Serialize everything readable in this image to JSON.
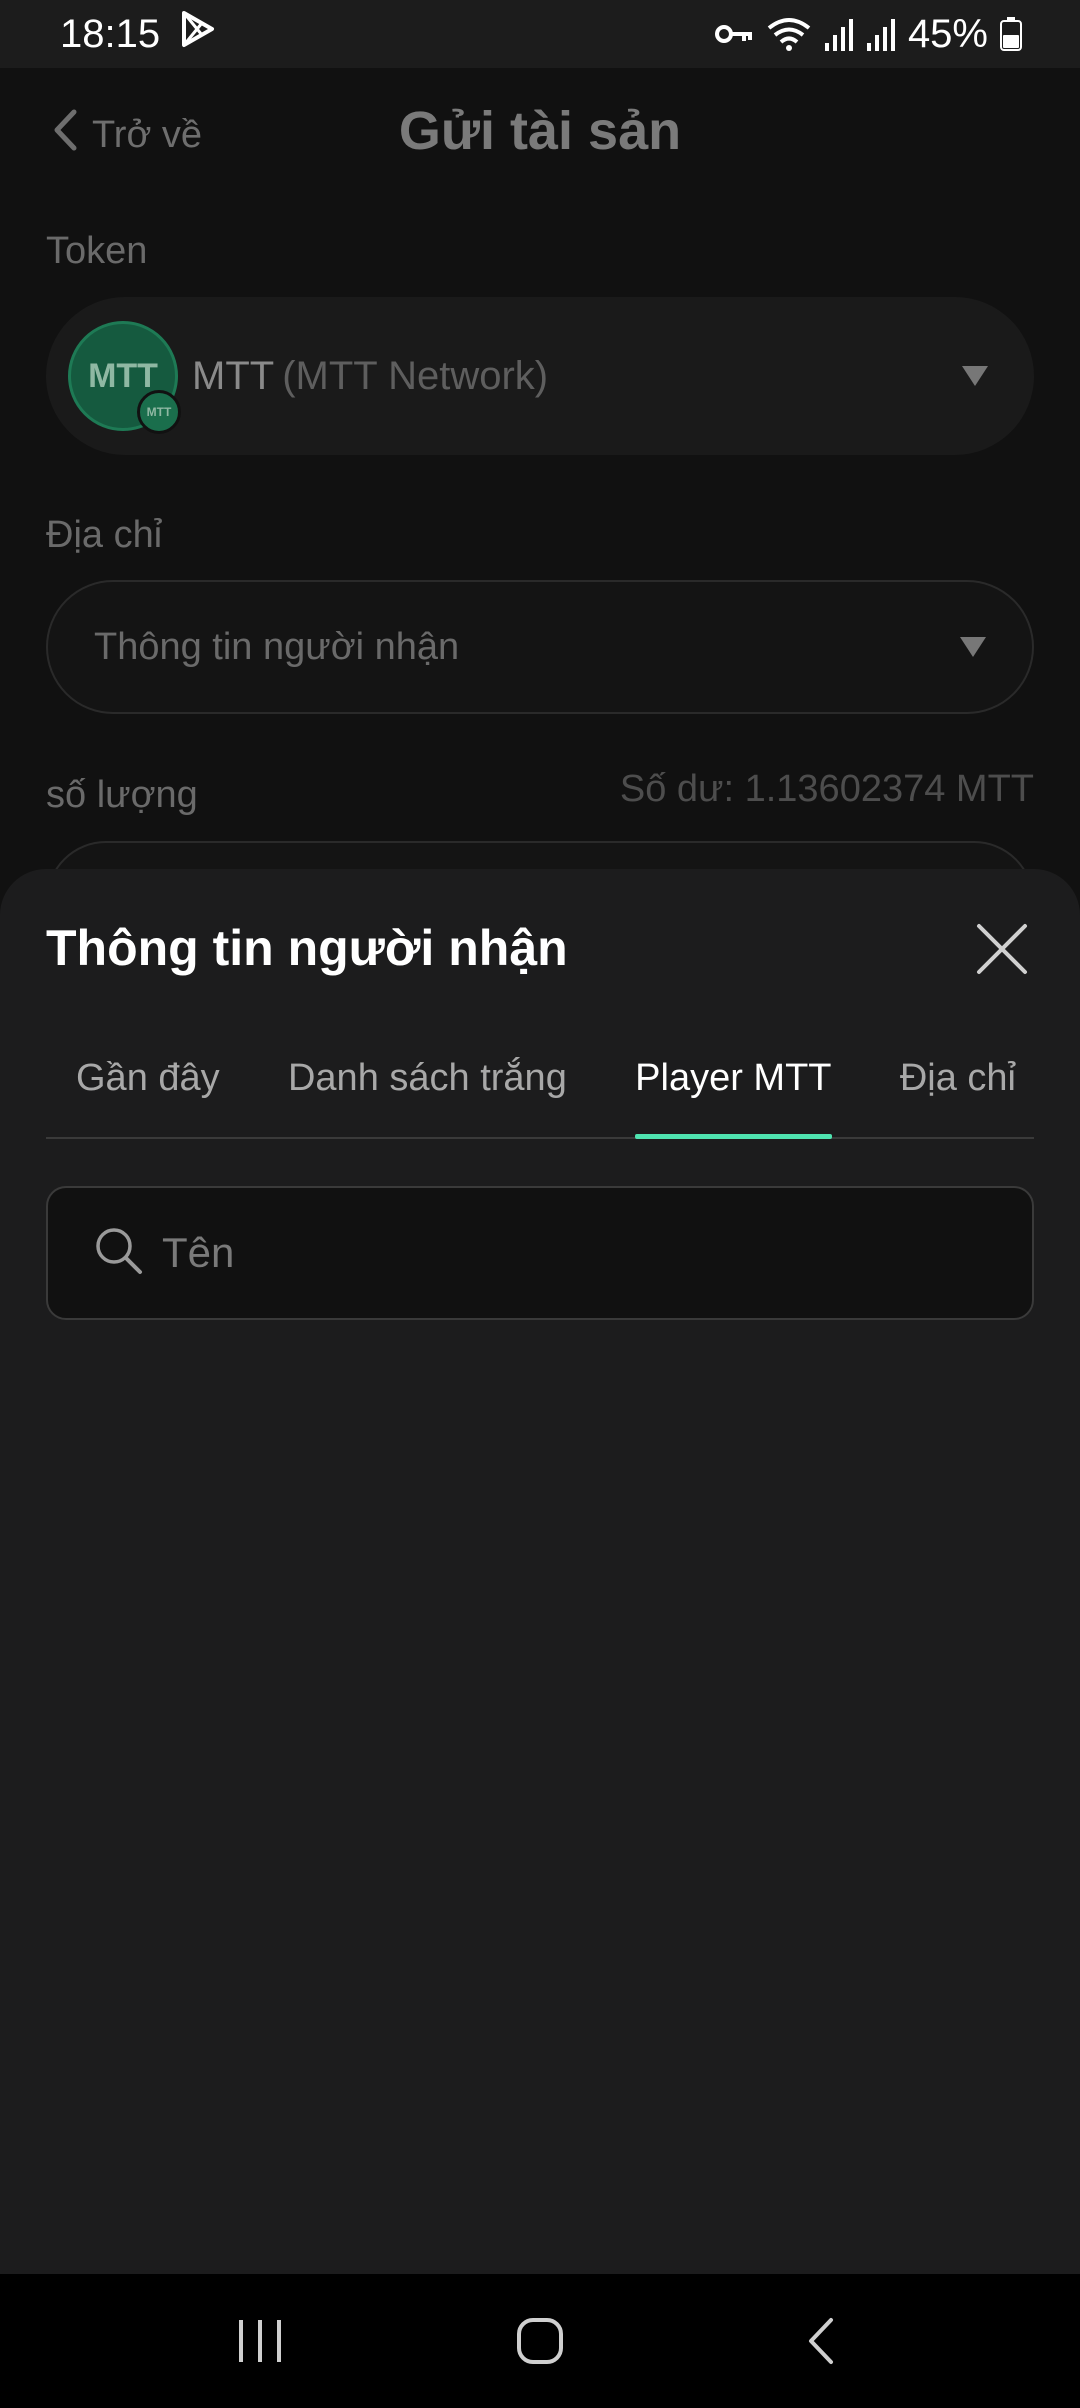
{
  "status_bar": {
    "time": "18:15",
    "battery": "45%",
    "icons": [
      "play-store-icon",
      "vpn-key-icon",
      "wifi-icon",
      "signal-icon",
      "signal-icon",
      "battery-icon"
    ]
  },
  "header": {
    "back_label": "Trở về",
    "title": "Gửi tài sản"
  },
  "form": {
    "token_label": "Token",
    "token_logo_text": "MTT",
    "token_symbol": "MTT",
    "token_network": "(MTT Network)",
    "address_label": "Địa chỉ",
    "address_placeholder": "Thông tin người nhận",
    "amount_label": "số lượng",
    "balance": "Số dư: 1.13602374 MTT"
  },
  "sheet": {
    "title": "Thông tin người nhận",
    "tabs": [
      {
        "label": "Gần đây",
        "active": false
      },
      {
        "label": "Danh sách trắng",
        "active": false
      },
      {
        "label": "Player MTT",
        "active": true
      },
      {
        "label": "Địa chỉ",
        "active": false
      }
    ],
    "search": {
      "placeholder": "Tên",
      "value": ""
    }
  },
  "colors": {
    "accent": "#4fe3b0",
    "sheet_bg": "#1c1c1d",
    "page_bg": "#111111"
  }
}
